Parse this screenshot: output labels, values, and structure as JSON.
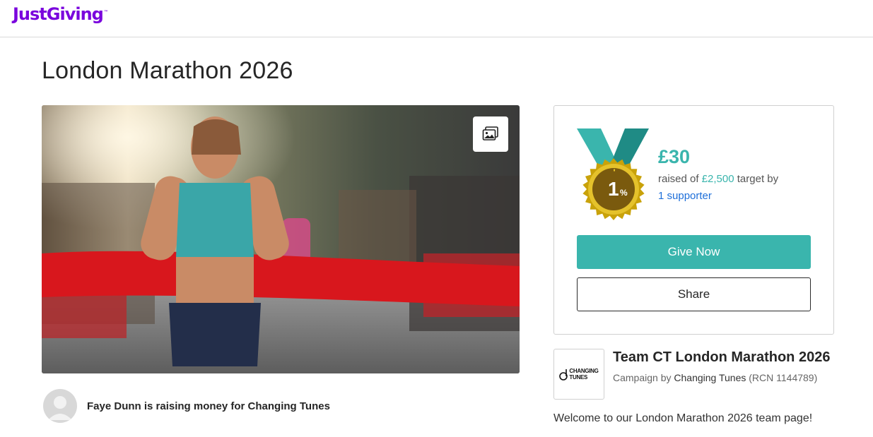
{
  "header": {
    "logo_text": "JustGiving",
    "logo_mark": "™"
  },
  "page": {
    "title": "London Marathon 2026"
  },
  "hero": {
    "gallery_icon": "image-gallery-icon"
  },
  "fundraiser": {
    "text": "Faye Dunn is raising money for Changing Tunes"
  },
  "donation": {
    "medal_percent": "1",
    "medal_percent_sign": "%",
    "progress_fraction": 0.012,
    "amount_raised": "£30",
    "raised_prefix": "raised of ",
    "target": "£2,500",
    "raised_suffix": " target by",
    "supporters": "1 supporter",
    "give_label": "Give Now",
    "share_label": "Share"
  },
  "campaign": {
    "logo_line1": "CHANGING",
    "logo_line2": "TUNES",
    "title": "Team CT London Marathon 2026",
    "by_prefix": "Campaign by ",
    "org": "Changing Tunes",
    "rcn": " (RCN 1144789)",
    "welcome": "Welcome to our London Marathon 2026 team page!"
  },
  "colors": {
    "brand_purple": "#7a04dd",
    "teal": "#3ab5ad",
    "link_blue": "#1e6fd9"
  }
}
